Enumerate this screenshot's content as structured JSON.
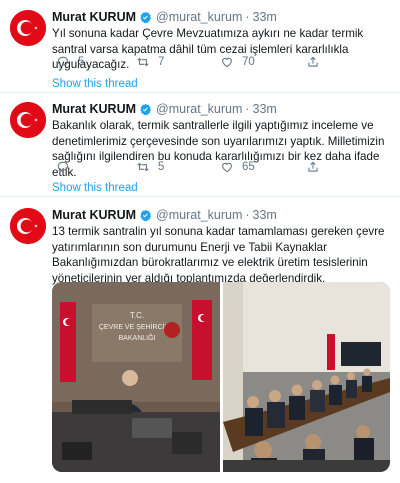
{
  "tweets": [
    {
      "author_name": "Murat KURUM",
      "handle": "@murat_kurum",
      "separator": "·",
      "time": "33m",
      "text": "Yıl sonuna kadar Çevre Mevzuatımıza aykırı ne kadar termik santral varsa kapatma dâhil tüm cezai işlemleri kararlılıkla uygulayacağız.",
      "replies": "5",
      "retweets": "7",
      "likes": "70",
      "show_thread": "Show this thread"
    },
    {
      "author_name": "Murat KURUM",
      "handle": "@murat_kurum",
      "separator": "·",
      "time": "33m",
      "text": "Bakanlık olarak, termik santrallerle ilgili yaptığımız inceleme ve denetimlerimiz çerçevesinde son uyarılarımızı yaptık. Milletimizin sağlığını ilgilendiren bu konuda kararlılığımızı bir kez daha ifade ettik.",
      "replies": "",
      "retweets": "5",
      "likes": "65",
      "show_thread": "Show this thread"
    },
    {
      "author_name": "Murat KURUM",
      "handle": "@murat_kurum",
      "separator": "·",
      "time": "33m",
      "text": "13 termik santralin yıl sonuna kadar tamamlaması gereken çevre yatırımlarının son durumunu Enerji ve Tabii Kaynaklar Bakanlığımızdan bürokratlarımız ve elektrik üretim tesislerinin yöneticilerinin yer aldığı toplantımızda değerlendirdik.",
      "photo_sign": [
        "T.C.",
        "ÇEVRE VE ŞEHİRCİLİK",
        "BAKANLIĞI"
      ]
    }
  ],
  "colors": {
    "accent": "#1da1f2",
    "muted": "#657786",
    "avatar_red": "#e30a17",
    "divider": "#e6ecf0"
  },
  "icons": [
    "verified-badge-icon",
    "reply-icon",
    "retweet-icon",
    "like-icon",
    "share-icon"
  ]
}
